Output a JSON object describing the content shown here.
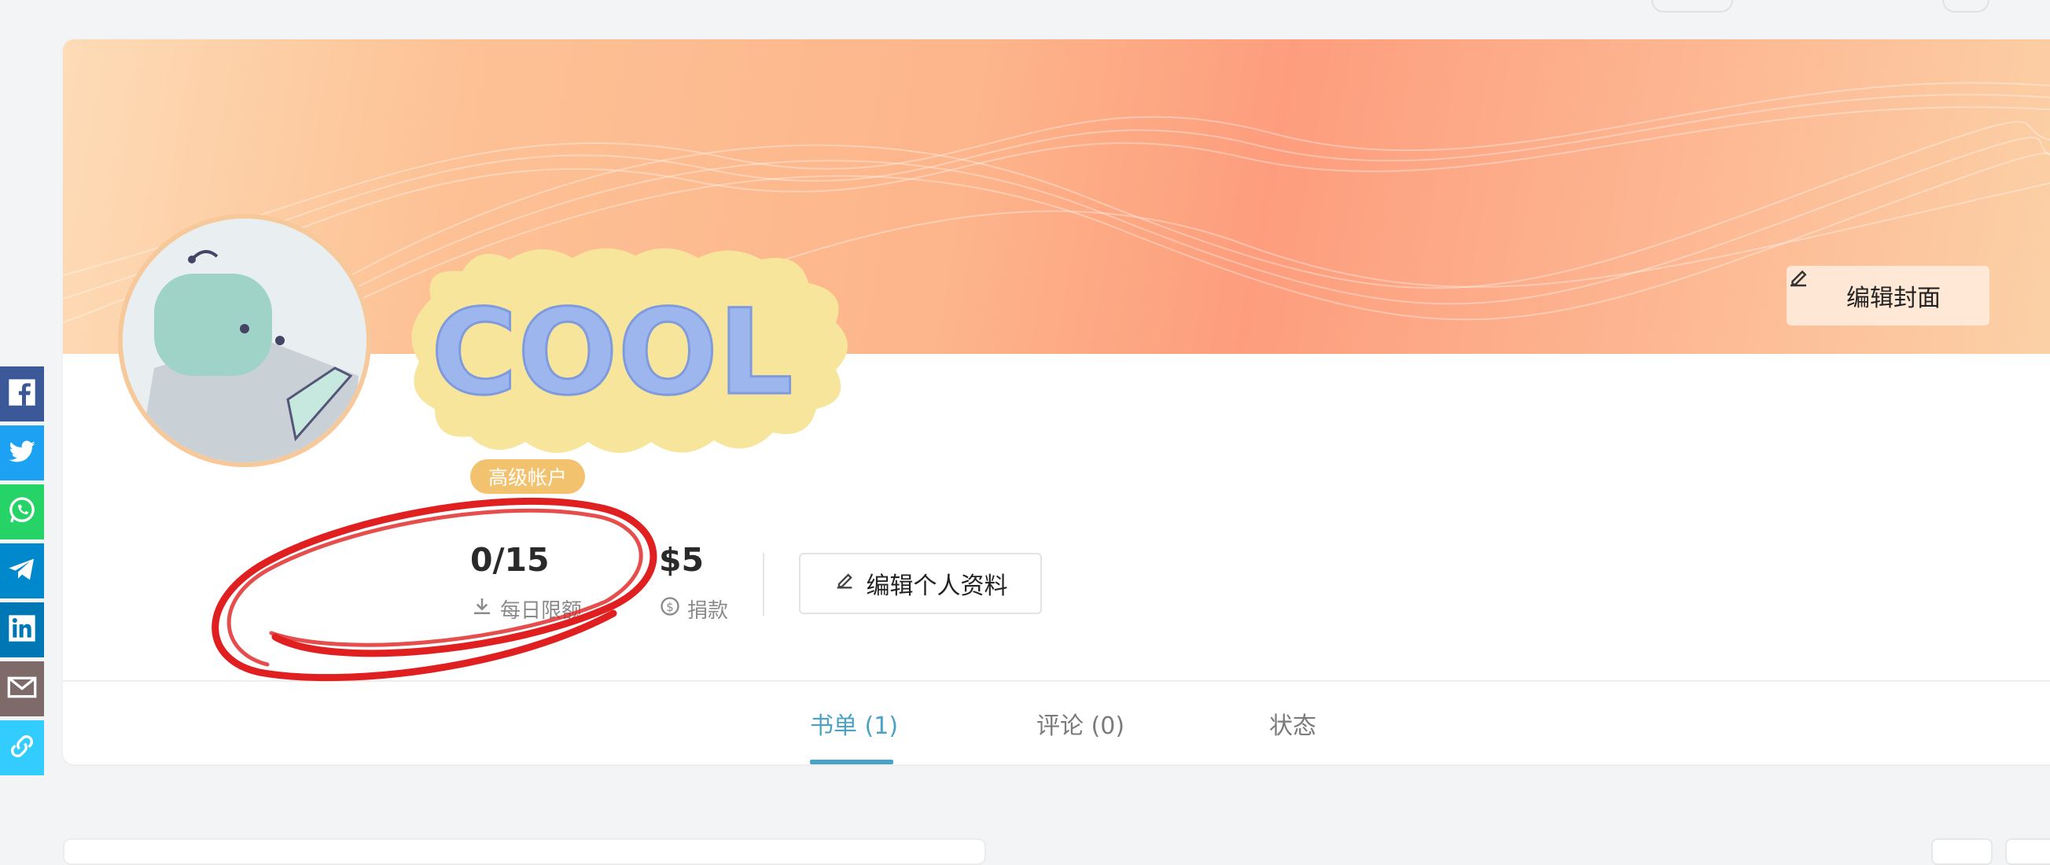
{
  "profile": {
    "account_badge": "高级帐户",
    "edit_cover_label": "编辑封面",
    "edit_profile_label": "编辑个人资料",
    "sticker_text": "COOL"
  },
  "stats": {
    "downloads_value": "0/15",
    "downloads_label": "每日限额",
    "donation_value": "$5",
    "donation_label": "捐款"
  },
  "tabs": [
    {
      "label": "书单 (1)",
      "active": true
    },
    {
      "label": "评论 (0)",
      "active": false
    },
    {
      "label": "状态",
      "active": false
    }
  ],
  "share_buttons": [
    {
      "icon": "facebook-icon",
      "color": "#3b5998"
    },
    {
      "icon": "twitter-icon",
      "color": "#1da1f2"
    },
    {
      "icon": "whatsapp-icon",
      "color": "#25d366"
    },
    {
      "icon": "telegram-icon",
      "color": "#0088cc"
    },
    {
      "icon": "linkedin-icon",
      "color": "#0077b5"
    },
    {
      "icon": "email-icon",
      "color": "#7f6a6a"
    },
    {
      "icon": "link-icon",
      "color": "#33ccff"
    }
  ],
  "colors": {
    "accent": "#4aa3c4",
    "badge": "#f3c26e",
    "annotation": "#e02020"
  }
}
